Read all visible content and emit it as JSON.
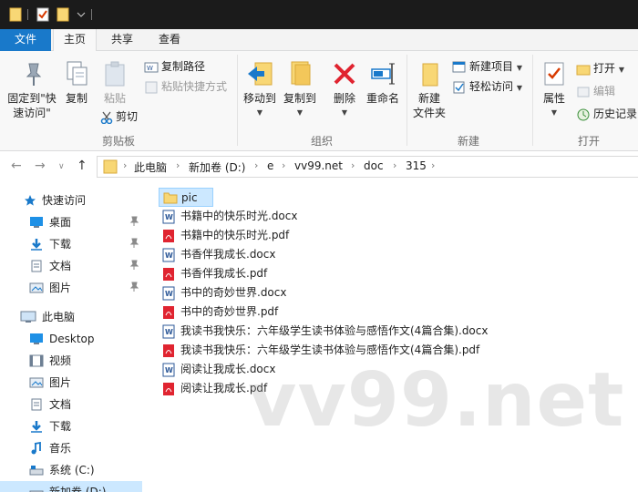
{
  "colors": {
    "file_tab": "#1979ca",
    "selection": "#cce8ff",
    "folder": "#f8d775",
    "word": "#2b5797",
    "pdf": "#e02430",
    "titlebar": "#1b1b1b"
  },
  "ribbon": {
    "tabs": [
      {
        "label": "文件"
      },
      {
        "label": "主页"
      },
      {
        "label": "共享"
      },
      {
        "label": "查看"
      }
    ],
    "clipboard": {
      "pin_line1": "固定到\"快",
      "pin_line2": "速访问\"",
      "copy": "复制",
      "paste": "粘贴",
      "copy_path": "复制路径",
      "paste_shortcut": "粘贴快捷方式",
      "cut": "剪切",
      "group": "剪贴板"
    },
    "organize": {
      "move_to": "移动到",
      "copy_to": "复制到",
      "delete": "删除",
      "rename": "重命名",
      "group": "组织"
    },
    "new": {
      "new_folder_line1": "新建",
      "new_folder_line2": "文件夹",
      "new_item": "新建项目",
      "easy_access": "轻松访问",
      "group": "新建"
    },
    "open": {
      "properties": "属性",
      "open": "打开",
      "edit": "编辑",
      "history": "历史记录",
      "group": "打开"
    }
  },
  "address": {
    "crumbs": [
      "此电脑",
      "新加卷 (D:)",
      "e",
      "vv99.net",
      "doc",
      "315"
    ]
  },
  "nav": {
    "quick_access": "快速访问",
    "quick_items": [
      {
        "label": "桌面",
        "icon": "desktop-icon"
      },
      {
        "label": "下载",
        "icon": "download-icon"
      },
      {
        "label": "文档",
        "icon": "documents-icon"
      },
      {
        "label": "图片",
        "icon": "pictures-icon"
      }
    ],
    "this_pc": "此电脑",
    "pc_items": [
      {
        "label": "Desktop",
        "icon": "desktop-icon"
      },
      {
        "label": "视频",
        "icon": "video-icon"
      },
      {
        "label": "图片",
        "icon": "pictures-icon"
      },
      {
        "label": "文档",
        "icon": "documents-icon"
      },
      {
        "label": "下载",
        "icon": "download-icon"
      },
      {
        "label": "音乐",
        "icon": "music-icon"
      },
      {
        "label": "系统 (C:)",
        "icon": "drive-icon"
      },
      {
        "label": "新加卷 (D:)",
        "icon": "drive-icon"
      }
    ]
  },
  "files": [
    {
      "name": "pic",
      "type": "folder"
    },
    {
      "name": "书籍中的快乐时光.docx",
      "type": "docx"
    },
    {
      "name": "书籍中的快乐时光.pdf",
      "type": "pdf"
    },
    {
      "name": "书香伴我成长.docx",
      "type": "docx"
    },
    {
      "name": "书香伴我成长.pdf",
      "type": "pdf"
    },
    {
      "name": "书中的奇妙世界.docx",
      "type": "docx"
    },
    {
      "name": "书中的奇妙世界.pdf",
      "type": "pdf"
    },
    {
      "name": "我读书我快乐：六年级学生读书体验与感悟作文(4篇合集).docx",
      "type": "docx"
    },
    {
      "name": "我读书我快乐：六年级学生读书体验与感悟作文(4篇合集).pdf",
      "type": "pdf"
    },
    {
      "name": "阅读让我成长.docx",
      "type": "docx"
    },
    {
      "name": "阅读让我成长.pdf",
      "type": "pdf"
    }
  ],
  "watermark": "vv99.net"
}
